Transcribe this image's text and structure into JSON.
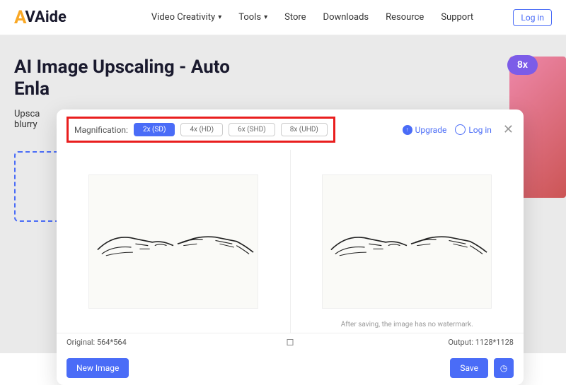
{
  "header": {
    "logo_text": "VAide",
    "nav": [
      "Video Creativity",
      "Tools",
      "Store",
      "Downloads",
      "Resource",
      "Support"
    ],
    "login": "Log in"
  },
  "page": {
    "title_line1": "AI Image Upscaling - Auto",
    "title_line2": "Enla",
    "desc_line1": "Upsca",
    "desc_line2": "blurry",
    "badge": "8x"
  },
  "modal": {
    "mag_label": "Magnification:",
    "mag_options": [
      "2x (SD)",
      "4x (HD)",
      "6x (SHD)",
      "8x (UHD)"
    ],
    "upgrade": "Upgrade",
    "login": "Log in",
    "watermark_note": "After saving, the image has no watermark.",
    "original_label": "Original: 564*564",
    "output_label": "Output: 1128*1128",
    "new_image": "New Image",
    "save": "Save"
  }
}
